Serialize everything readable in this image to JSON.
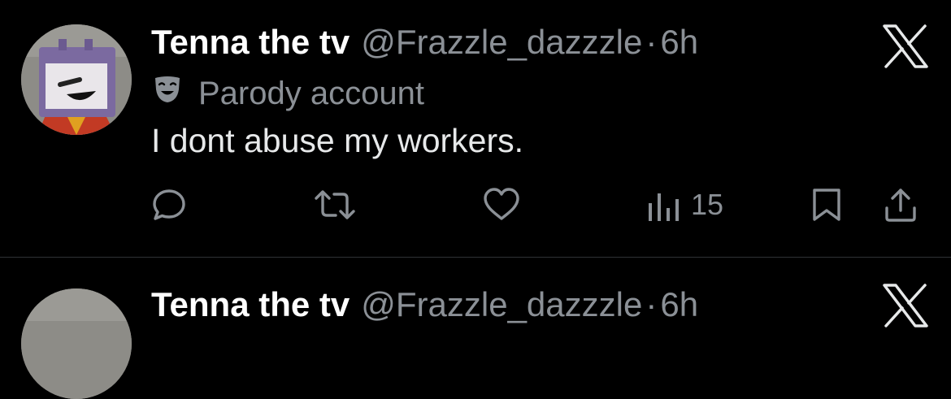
{
  "posts": [
    {
      "author_name": "Tenna the tv",
      "handle": "@Frazzle_dazzzle",
      "separator": "·",
      "time": "6h",
      "label": "Parody account",
      "text": "I dont abuse my workers.",
      "views": "15"
    },
    {
      "author_name": "Tenna the tv",
      "handle": "@Frazzle_dazzzle",
      "separator": "·",
      "time": "6h"
    }
  ],
  "icons": {
    "reply": "reply-icon",
    "repost": "repost-icon",
    "like": "heart-icon",
    "views": "views-icon",
    "bookmark": "bookmark-icon",
    "share": "share-icon",
    "close": "x-close-icon",
    "parody": "parody-mask-icon"
  },
  "colors": {
    "background": "#000000",
    "primary_text": "#e7e9ea",
    "secondary_text": "#8b9096",
    "divider": "#2f3336"
  }
}
